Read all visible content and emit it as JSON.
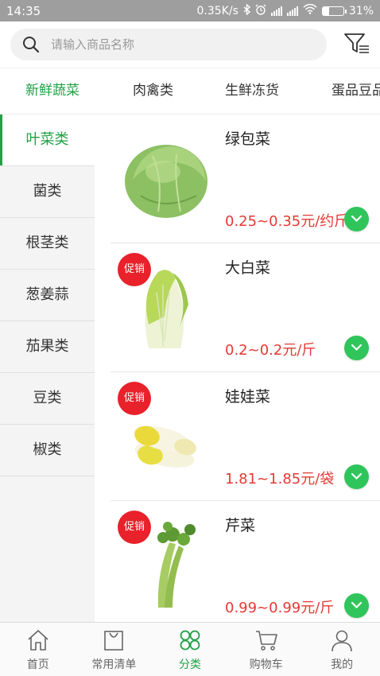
{
  "status_bar": {
    "time": "14:35",
    "speed": "0.35K/s",
    "battery": "31%",
    "battery_level": 0.31
  },
  "search": {
    "placeholder": "请输入商品名称",
    "icon": "search-icon",
    "filter_icon": "filter-icon"
  },
  "categories": [
    {
      "label": "新鲜蔬菜",
      "active": true
    },
    {
      "label": "肉禽类",
      "active": false
    },
    {
      "label": "生鲜冻货",
      "active": false
    },
    {
      "label": "蛋品豆品",
      "active": false
    }
  ],
  "subcategories": [
    {
      "label": "叶菜类",
      "active": true
    },
    {
      "label": "菌类",
      "active": false
    },
    {
      "label": "根茎类",
      "active": false
    },
    {
      "label": "葱姜蒜",
      "active": false
    },
    {
      "label": "茄果类",
      "active": false
    },
    {
      "label": "豆类",
      "active": false
    },
    {
      "label": "椒类",
      "active": false
    }
  ],
  "products": [
    {
      "name": "绿包菜",
      "price": "0.25~0.35元/约斤",
      "promo": "",
      "image": "cabbage"
    },
    {
      "name": "大白菜",
      "price": "0.2~0.2元/斤",
      "promo": "促销",
      "image": "napa-cabbage"
    },
    {
      "name": "娃娃菜",
      "price": "1.81~1.85元/袋",
      "promo": "促销",
      "image": "baby-cabbage"
    },
    {
      "name": "芹菜",
      "price": "0.99~0.99元/斤",
      "promo": "促销",
      "image": "celery"
    }
  ],
  "tabbar": [
    {
      "label": "首页",
      "icon": "home-icon",
      "active": false
    },
    {
      "label": "常用清单",
      "icon": "list-bag-icon",
      "active": false
    },
    {
      "label": "分类",
      "icon": "category-icon",
      "active": true
    },
    {
      "label": "购物车",
      "icon": "cart-icon",
      "active": false
    },
    {
      "label": "我的",
      "icon": "profile-icon",
      "active": false
    }
  ],
  "colors": {
    "accent": "#22a046",
    "price": "#e53935",
    "promo": "#e8212a",
    "add_button": "#2fc55a"
  }
}
